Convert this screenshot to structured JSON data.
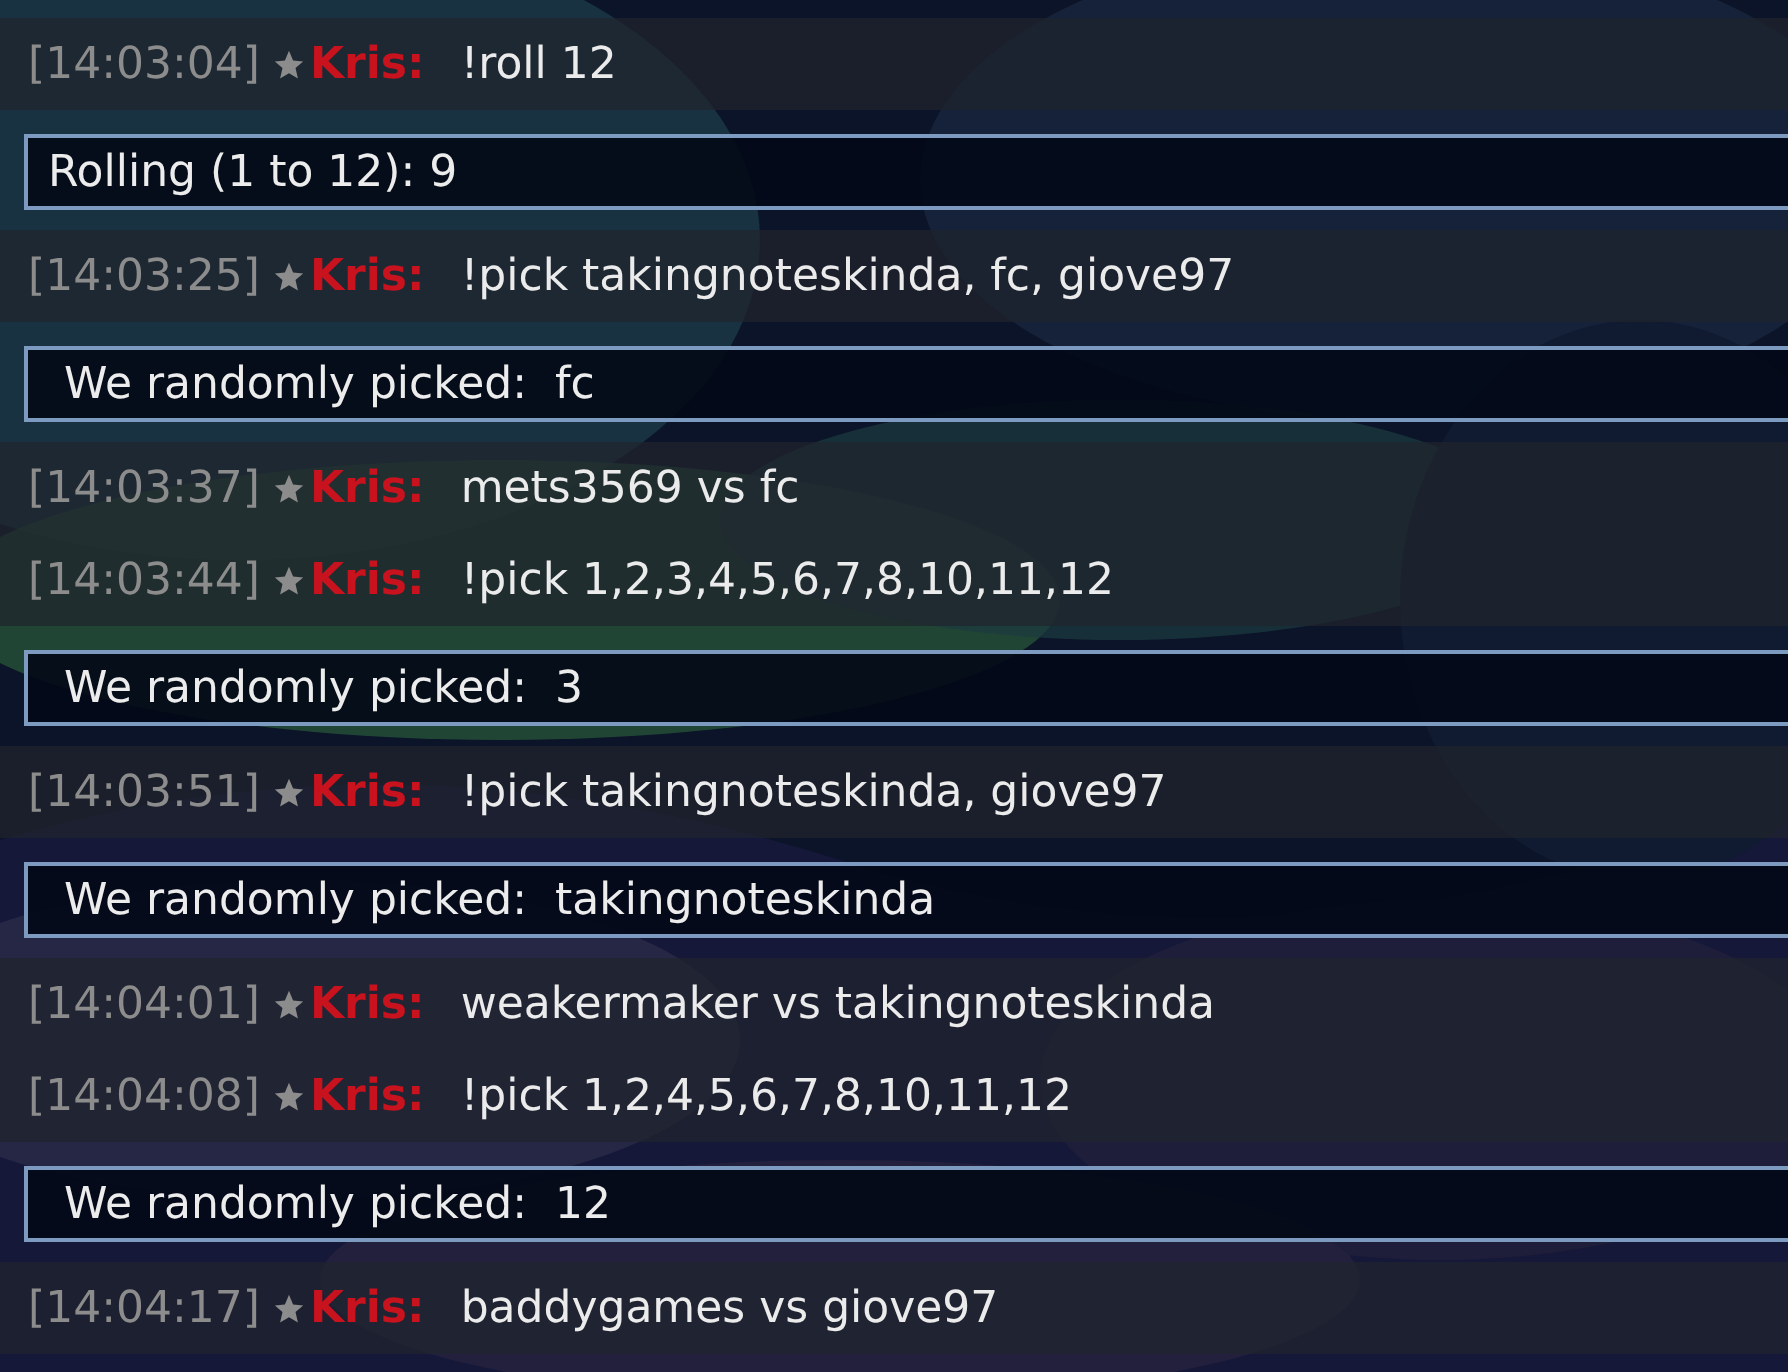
{
  "messages": [
    {
      "kind": "chat",
      "time": "[14:03:04]",
      "user": "Kris:",
      "text": "!roll 12"
    },
    {
      "kind": "roll",
      "text": "Rolling (1 to 12): 9"
    },
    {
      "kind": "chat",
      "time": "[14:03:25]",
      "user": "Kris:",
      "text": "!pick takingnoteskinda, fc, giove97"
    },
    {
      "kind": "pick",
      "text": "We randomly picked:  fc"
    },
    {
      "kind": "chat",
      "time": "[14:03:37]",
      "user": "Kris:",
      "text": "mets3569 vs fc"
    },
    {
      "kind": "chat",
      "time": "[14:03:44]",
      "user": "Kris:",
      "text": "!pick 1,2,3,4,5,6,7,8,10,11,12"
    },
    {
      "kind": "pick",
      "text": "We randomly picked:  3"
    },
    {
      "kind": "chat",
      "time": "[14:03:51]",
      "user": "Kris:",
      "text": "!pick takingnoteskinda, giove97"
    },
    {
      "kind": "pick",
      "text": "We randomly picked:  takingnoteskinda"
    },
    {
      "kind": "chat",
      "time": "[14:04:01]",
      "user": "Kris:",
      "text": "weakermaker vs takingnoteskinda"
    },
    {
      "kind": "chat",
      "time": "[14:04:08]",
      "user": "Kris:",
      "text": "!pick 1,2,4,5,6,7,8,10,11,12"
    },
    {
      "kind": "pick",
      "text": "We randomly picked:  12"
    },
    {
      "kind": "chat",
      "time": "[14:04:17]",
      "user": "Kris:",
      "text": "baddygames vs giove97"
    }
  ]
}
